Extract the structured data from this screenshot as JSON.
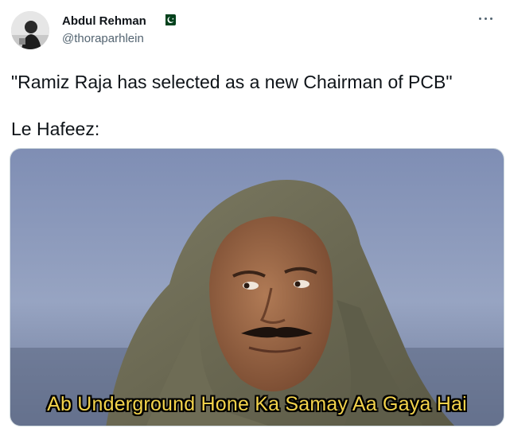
{
  "tweet": {
    "author": {
      "display_name": "Abdul Rehman",
      "handle": "@thoraparhlein",
      "flag_icon": "pakistan-flag-icon",
      "avatar_icon": "avatar-photo"
    },
    "more_icon": "more-horizontal-icon",
    "text_line_1": "\"Ramiz Raja has selected as a new Chairman of PCB\"",
    "text_line_2": "Le Hafeez:",
    "media": {
      "caption": "Ab Underground Hone Ka Samay Aa Gaya Hai",
      "caption_color": "#f2d24b"
    }
  }
}
